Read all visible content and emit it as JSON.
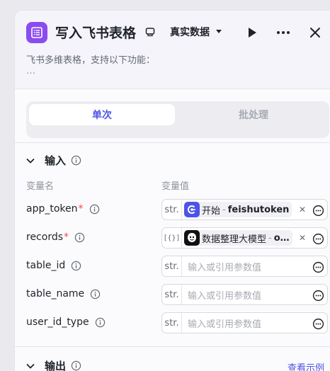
{
  "header": {
    "title": "写入飞书表格",
    "mode": "真实数据",
    "description": "飞书多维表格，支持以下功能：",
    "description_more": "…"
  },
  "tabs": [
    {
      "label": "单次",
      "active": true
    },
    {
      "label": "批处理",
      "active": false
    }
  ],
  "input_section": {
    "title": "输入",
    "col_name": "变量名",
    "col_value": "变量值",
    "rows": [
      {
        "name": "app_token",
        "required": true,
        "type": "str.",
        "kind": "ref",
        "source": "开始",
        "variable": "feishutoken"
      },
      {
        "name": "records",
        "required": true,
        "type": "[{}]",
        "kind": "ref",
        "source": "数据整理大模型",
        "variable": "o…"
      },
      {
        "name": "table_id",
        "required": false,
        "type": "str.",
        "kind": "input",
        "placeholder": "输入或引用参数值"
      },
      {
        "name": "table_name",
        "required": false,
        "type": "str.",
        "kind": "input",
        "placeholder": "输入或引用参数值"
      },
      {
        "name": "user_id_type",
        "required": false,
        "type": "str.",
        "kind": "input",
        "placeholder": "输入或引用参数值"
      }
    ]
  },
  "output_section": {
    "title": "输出",
    "examples_link": "查看示例"
  },
  "colors": {
    "accent": "#4d53e8",
    "app_icon": "#8a4cf0",
    "required": "#f54a45",
    "start_node": "#4d53e8"
  }
}
